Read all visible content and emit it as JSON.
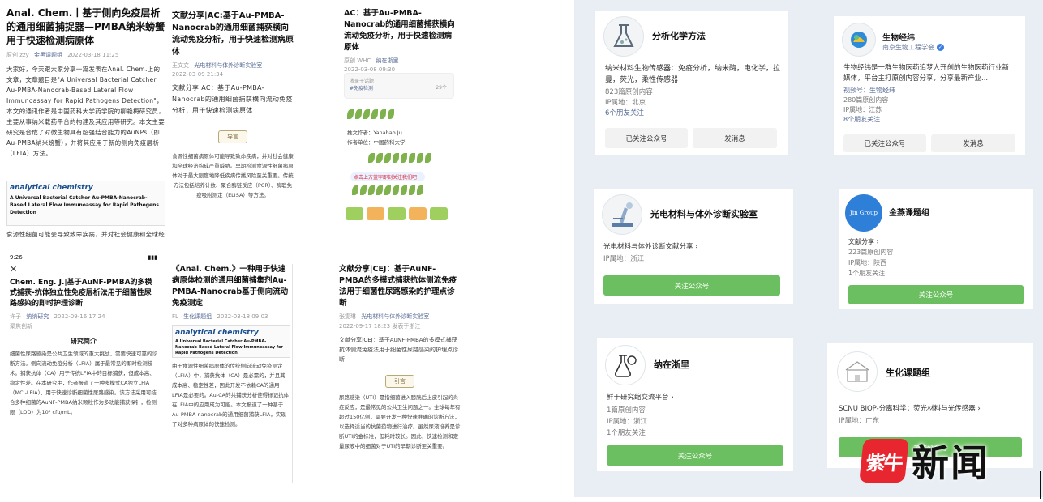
{
  "articles": {
    "a1": {
      "title": "Anal. Chem.丨基于侧向免疫层析的通用细菌捕捉器—PMBA纳米螃蟹用于快速检测病原体",
      "meta_tag": "原创",
      "meta_author": "zzy",
      "meta_account": "金黑课题组",
      "meta_time": "2022-03-18 11:25",
      "body": "大家好，今天跟大家分享一篇发表在Anal. Chem.上的文章，文章题目是\"A Universal Bacterial Catcher Au-PMBA-Nanocrab-Based Lateral Flow Immunoassay for Rapid Pathogens Detection\"，本文的通讯作者是中国药科大学药学院的柳艳梅研究员，主要从事纳米载药平台的构建及其应用等研究。本文主要研究是合成了对微生物具有超强结合能力的AuNPs（即Au-PMBA纳米螃蟹），并将其应用于新的侧向免疫层析（LFIA）方法。",
      "fig_logo": "analytical chemistry",
      "fig_title": "A Universal Bacterial Catcher Au-PMBA-Nanocrab-Based Lateral Flow Immunoassay for Rapid Pathogens Detection",
      "tail": "食源性细菌可能会导致致命疾病，并对社会健康和全球经济构成严重威胁。早期检"
    },
    "a2": {
      "title": "文献分享|AC:基于Au-PMBA-Nanocrab的通用细菌捕获横向流动免疫分析，用于快速检测病原体",
      "meta_author": "王文文",
      "meta_account": "光电材料与体外诊断实验室",
      "meta_time": "2022-03-09 21:34",
      "body": "文献分享|AC：基于Au-PMBA-Nanocrab的通用细菌捕获横向流动免疫分析，用于快速检测病原体",
      "lead": "导言",
      "tail": "食源性细菌病原体可能导致致命疾病，并对社会健康和全球经济构成严重威胁。早期检测食源性细菌病原体对于最大限度地降低疾病传播风险至关重要。传统方法包括培养计数、聚合酶链反应（PCR）、酶联免疫吸附测定（ELISA）等方法。"
    },
    "a3": {
      "title": "AC：基于Au-PMBA-Nanocrab的通用细菌捕获横向流动免疫分析，用于快速检测病原体",
      "meta_tag": "原创",
      "meta_author": "WHC",
      "meta_account": "纳在浙里",
      "meta_time": "2022-03-08 09:30",
      "collection_label": "收录于话题",
      "collection_value": "#免疫检测",
      "collection_count": "29个",
      "author_label": "推文作者：Yanahao Ju",
      "unit_label": "作者单位：中国药科大学",
      "banner": "点击上方蓝字即刻关注我们吧！"
    },
    "a4": {
      "status_time": "9:26",
      "close": "✕",
      "title": "Chem. Eng. J.|基于AuNF-PMBA的多模式捕获-抗体独立性免疫层析法用于细菌性尿路感染的即时护理诊断",
      "meta_author": "许子",
      "meta_account": "纳纳研究",
      "meta_time": "2022-09-16 17:24",
      "sub": "聚焦创新",
      "section": "研究简介",
      "body": "细菌性尿路感染是公共卫生领域的重大挑战，需要快速可靠的诊断方法。侧向流动免疫分析（LFIA）属于最常见的即时检测技术。捕获抗体（CA）用于传统LFIA中的目标捕获，但成本高、稳定性差。在本研究中，作者报道了一种多模式CA独立LFIA（MCI-LFIA），用于快速诊断细菌性尿路感染。该方法采用可结合多种细菌的AuNF-PMBA纳米颗粒作为多功能捕获探针，检测限（LOD）为10³ cfu/mL。"
    },
    "a5": {
      "title": "《Anal. Chem.》一种用于快速病原体检测的通用细菌捕集剂Au-PMBA-Nanocrab基于侧向流动免疫测定",
      "meta_author": "FL",
      "meta_account": "生化课题组",
      "meta_time": "2022-03-18 09:03",
      "fig_logo": "analytical chemistry",
      "fig_title": "A Universal Bacterial Catcher Au-PMBA-Nanocrab-Based Lateral Flow Immunoassay for Rapid Pathogens Detection",
      "body": "由于食源性细菌病原体的传统侧向流动免疫测定（LFIA）中，捕获抗体（CA）是必需的，并且其成本高、稳定性差，因此开发不依赖CA的通用LFIA是必要的。Au-CA的共捕获分析使得标记抗体在LFIA中的应用成为可能。本文报道了一种基于Au-PMBA-nanocrab的通用细菌捕获LFIA，实现了对多种病原体的快速检测。"
    },
    "a6": {
      "title": "文献分享|CEJ：基于AuNF-PMBA的多模式捕获抗体侧流免疫法用于细菌性尿路感染的护理点诊断",
      "meta_author": "张雯琳",
      "meta_account": "光电材料与体外诊断实验室",
      "meta_time": "2022-09-17 18:23",
      "meta_loc": "发表于浙江",
      "body": "文献分享|CEJ：基于AuNF-PMBA的多模式捕获抗体侧流免疫法用于细菌性尿路感染的护理点诊断",
      "lead": "引言",
      "tail": "尿路感染（UTI）是指细菌进入膀胱后上皮引起的炎症反应，是最常见的公共卫生问题之一。全球每年有超过150亿例，需要开发一种快速准确的诊断方法，以选择适当的抗菌药物进行治疗。虽然尿液培养是诊断UTI的金标准，但耗时较长。因此，快速检测和定量尿液中的细菌对于UTI的早期诊断至关重要。"
    }
  },
  "accounts": [
    {
      "name": "分析化学方法",
      "desc": "纳米材料生物传感器：免疫分析，纳米酶，电化学，拉曼，荧光，柔性传感器",
      "stat1": "823篇原创内容",
      "stat2": "IP属地：北京",
      "stat3": "6个朋友关注",
      "btn_left": "已关注公众号",
      "btn_right": "发消息",
      "avatar_icon": "lab-glassware-icon"
    },
    {
      "name": "生物经纬",
      "org": "南京生物工程学会",
      "desc": "生物经纬是一群生物医药追梦人开创的生物医药行业新媒体，平台主打原创内容分享，分享最新产业...",
      "stat1": "视频号：生物经纬",
      "stat2": "280篇原创内容",
      "stat3": "IP属地：江苏",
      "stat4": "8个朋友关注",
      "btn_left": "已关注公众号",
      "btn_right": "发消息",
      "avatar_icon": "biology-logo-icon"
    },
    {
      "name": "光电材料与体外诊断实验室",
      "desc": "光电材料与体外诊断文献分享",
      "stat1": "IP属地：浙江",
      "btn": "关注公众号",
      "avatar_icon": "microscope-icon"
    },
    {
      "name": "金燕课题组",
      "avatar_text": "Jin Group",
      "desc": "文献分享",
      "stat1": "223篇原创内容",
      "stat2": "IP属地：陕西",
      "stat3": "1个朋友关注",
      "btn": "关注公众号"
    },
    {
      "name": "纳在浙里",
      "desc": "鲜于研究缩交流平台",
      "stat1": "1篇原创内容",
      "stat2": "IP属地：浙江",
      "stat3": "1个朋友关注",
      "btn": "关注公众号",
      "avatar_icon": "flask-sketch-icon"
    },
    {
      "name": "生化课题组",
      "desc": "SCNU BIOP-分离科学；荧光材料与光传感器",
      "stat1": "IP属地：广东",
      "btn": "关注公众号",
      "avatar_icon": "building-logo-icon"
    }
  ],
  "watermark": {
    "badge": "紫牛",
    "text": "新闻"
  },
  "colors": {
    "panel_bg": "#e9eef4",
    "follow_green": "#6cbf60",
    "link_blue": "#576b95",
    "watermark_red": "#e8262f"
  }
}
